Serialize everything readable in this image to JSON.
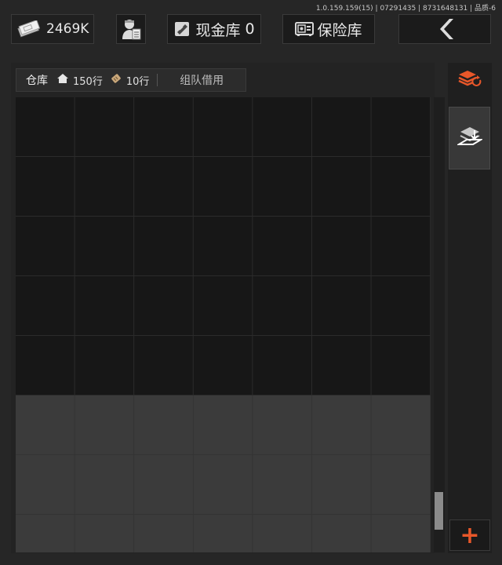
{
  "version": "1.0.159.159(15) | 07291435 | 8731648131 | 品质-6",
  "header": {
    "money": {
      "icon": "cash-stack-icon",
      "value": "2469K"
    },
    "agent": {
      "icon": "operator-portrait-icon"
    },
    "cash_vault": {
      "icon": "ticket-icon",
      "label": "现金库",
      "count": "0"
    },
    "safe_vault": {
      "icon": "safe-box-icon",
      "label": "保险库"
    },
    "back": {
      "icon": "chevron-left-icon"
    }
  },
  "warehouse": {
    "tab_label": "仓库",
    "rows_icon": "house-icon",
    "rows_value": "150行",
    "ticket_icon": "voucher-icon",
    "ticket_value": "10行",
    "team_tab_label": "组队借用"
  },
  "sidebar": {
    "sort_icon": "stack-sort-icon",
    "deposit_icon": "layers-download-icon",
    "add_icon": "plus-icon",
    "add_label": "+"
  },
  "colors": {
    "accent": "#e8572a",
    "background": "#262626",
    "grid_dark": "#171717",
    "grid_light": "#3b3b3b"
  }
}
